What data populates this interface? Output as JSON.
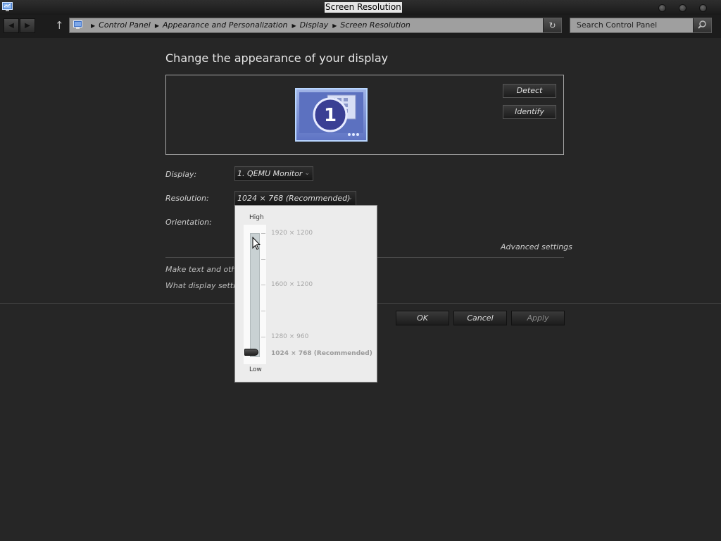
{
  "window": {
    "title": "Screen Resolution",
    "controls": [
      "minimize",
      "maximize",
      "close"
    ]
  },
  "nav": {
    "breadcrumb": [
      "Control Panel",
      "Appearance and Personalization",
      "Display",
      "Screen Resolution"
    ],
    "search_placeholder": "Search Control Panel"
  },
  "main": {
    "heading": "Change the appearance of your display",
    "monitor_number": "1",
    "detect_label": "Detect",
    "identify_label": "Identify",
    "display_label": "Display:",
    "display_value": "1. QEMU Monitor",
    "resolution_label": "Resolution:",
    "resolution_value": "1024 × 768 (Recommended)",
    "orientation_label": "Orientation:",
    "advanced_link": "Advanced settings",
    "link1": "Make text and other",
    "link2": "What display setting"
  },
  "buttons": {
    "ok": "OK",
    "cancel": "Cancel",
    "apply": "Apply"
  },
  "resolution_popup": {
    "high_label": "High",
    "low_label": "Low",
    "options": [
      "1920 × 1200",
      "1600 × 1200",
      "1280 × 960",
      "1024 × 768 (Recommended)"
    ],
    "selected": "1024 × 768 (Recommended)",
    "selected_position": 0.0
  },
  "colors": {
    "background": "#262626",
    "monitor_tile": "#6f84d0",
    "popup_bg": "#ececec"
  }
}
